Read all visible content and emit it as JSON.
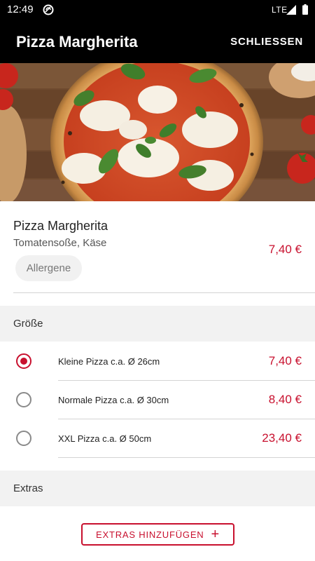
{
  "status_bar": {
    "time": "12:49",
    "network": "LTE"
  },
  "app_bar": {
    "title": "Pizza Margherita",
    "close_label": "SCHLIESSEN"
  },
  "product": {
    "name": "Pizza Margherita",
    "description": "Tomatensoße, Käse",
    "price": "7,40 €",
    "allergens_label": "Allergene"
  },
  "size_section": {
    "title": "Größe",
    "options": [
      {
        "label": "Kleine Pizza c.a. Ø 26cm",
        "price": "7,40 €",
        "selected": true
      },
      {
        "label": "Normale Pizza c.a. Ø 30cm",
        "price": "8,40 €",
        "selected": false
      },
      {
        "label": "XXL Pizza c.a. Ø 50cm",
        "price": "23,40 €",
        "selected": false
      }
    ]
  },
  "extras_section": {
    "title": "Extras",
    "add_button_label": "EXTRAS HINZUFÜGEN"
  },
  "colors": {
    "accent": "#c8102e",
    "appbar": "#000000",
    "section_bg": "#f2f2f2"
  }
}
